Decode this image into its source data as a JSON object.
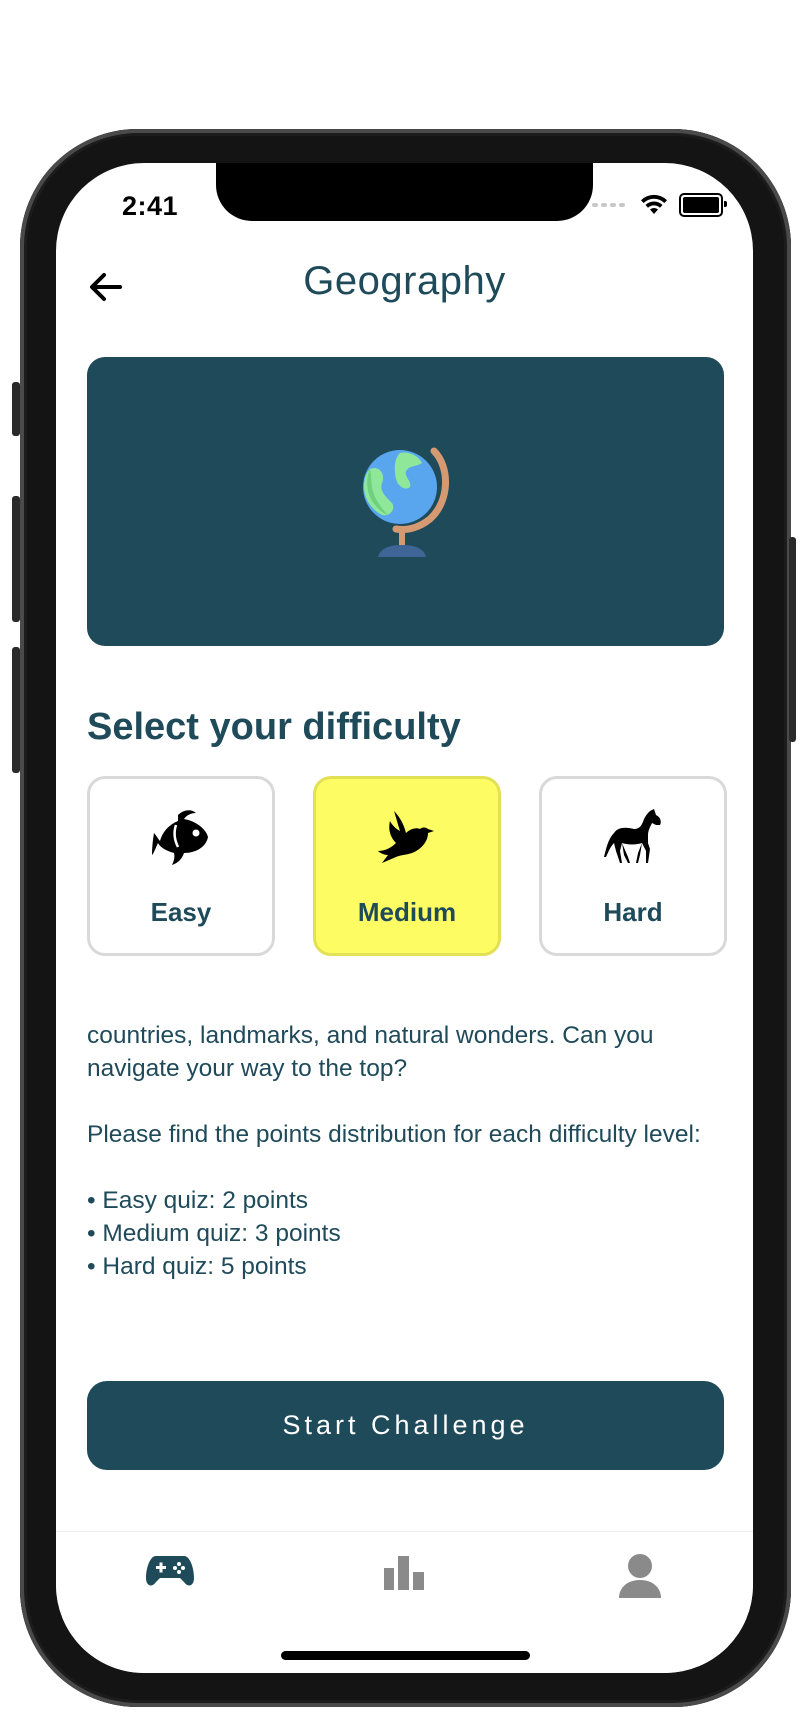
{
  "status_bar": {
    "time": "2:41"
  },
  "header": {
    "title": "Geography"
  },
  "hero": {
    "icon": "globe-icon"
  },
  "difficulty": {
    "heading": "Select your difficulty",
    "options": [
      {
        "label": "Easy",
        "icon": "fish-icon",
        "selected": false
      },
      {
        "label": "Medium",
        "icon": "bird-icon",
        "selected": true
      },
      {
        "label": "Hard",
        "icon": "horse-icon",
        "selected": false
      }
    ]
  },
  "description": {
    "paragraph_1": "countries, landmarks, and natural wonders. Can you navigate your way to the top?",
    "paragraph_2": "Please find the points distribution for each difficulty level:",
    "points": [
      "• Easy quiz: 2 points",
      "• Medium quiz: 3 points",
      "• Hard quiz: 5 points"
    ]
  },
  "cta": {
    "label": "Start Challenge"
  },
  "tabbar": {
    "items": [
      {
        "icon": "gamepad-icon",
        "active": true
      },
      {
        "icon": "leaderboard-icon",
        "active": false
      },
      {
        "icon": "profile-icon",
        "active": false
      }
    ]
  },
  "colors": {
    "primary": "#1f4a5a",
    "selected": "#fdfd63",
    "inactive_icon": "#8a8a8a"
  }
}
